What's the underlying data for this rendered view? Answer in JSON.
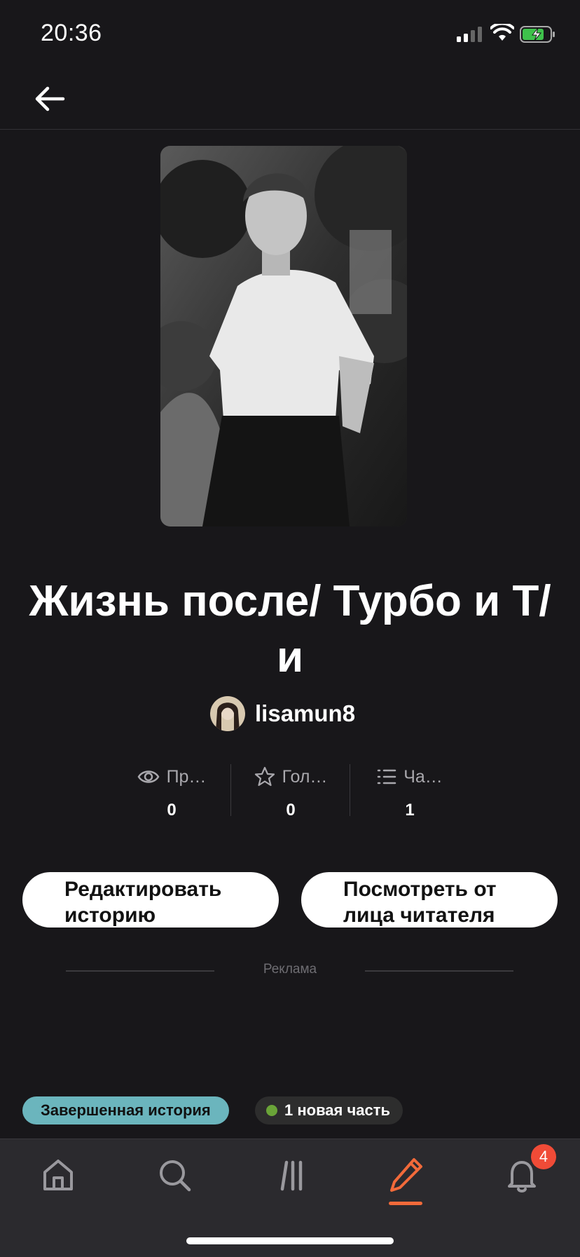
{
  "status_bar": {
    "time": "20:36"
  },
  "header": {
    "back_icon": "arrow-left-icon"
  },
  "story": {
    "title": "Жизнь после/ Турбо и Т/и",
    "author": "lisamun8"
  },
  "stats": [
    {
      "icon": "eye-icon",
      "label": "Пр…",
      "value": "0"
    },
    {
      "icon": "star-icon",
      "label": "Гол…",
      "value": "0"
    },
    {
      "icon": "list-icon",
      "label": "Ча…",
      "value": "1"
    }
  ],
  "actions": {
    "edit_label": "Редактировать историю",
    "preview_label": "Посмотреть от лица читателя"
  },
  "ad": {
    "label": "Реклама"
  },
  "tags": {
    "status": "Завершенная история",
    "new_parts": "1 новая часть"
  },
  "nav": {
    "items": [
      "home-icon",
      "search-icon",
      "library-icon",
      "write-icon",
      "bell-icon"
    ],
    "active": "write-icon",
    "notifications_count": "4"
  },
  "colors": {
    "background": "#18171a",
    "accent": "#f26a3a",
    "complete_tag": "#6bb5bd",
    "new_dot": "#6aa438",
    "badge": "#f04b37"
  }
}
